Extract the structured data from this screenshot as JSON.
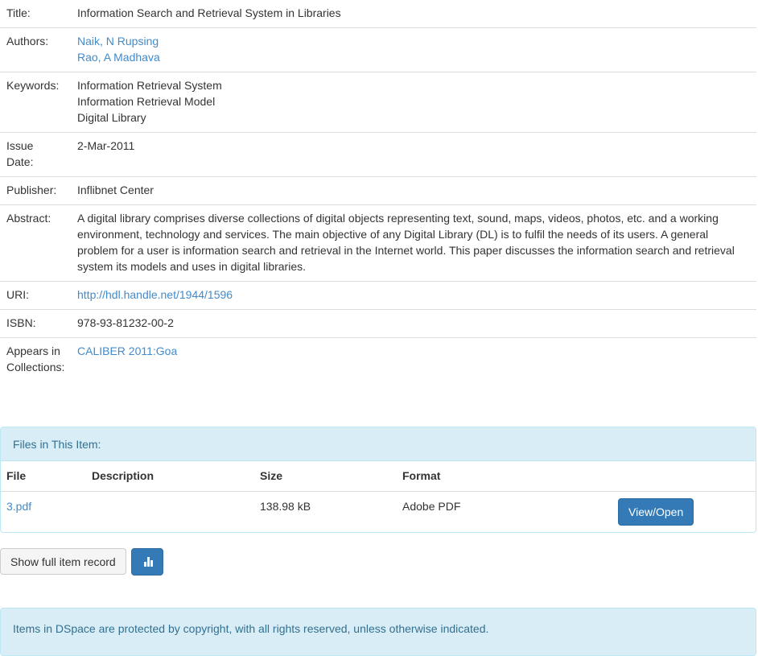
{
  "metadata": {
    "title_label": "Title:",
    "title": "Information Search and Retrieval System in Libraries",
    "authors_label": "Authors:",
    "authors": [
      "Naik, N Rupsing",
      "Rao, A Madhava"
    ],
    "keywords_label": "Keywords:",
    "keywords": [
      "Information Retrieval System",
      "Information Retrieval Model",
      "Digital Library"
    ],
    "issue_date_label_1": "Issue",
    "issue_date_label_2": "Date:",
    "issue_date": "2-Mar-2011",
    "publisher_label": "Publisher:",
    "publisher": "Inflibnet Center",
    "abstract_label": "Abstract:",
    "abstract": "A digital library comprises diverse collections of digital objects representing text, sound, maps, videos, photos, etc. and a working environment, technology and services. The main objective of any Digital Library (DL) is to fulfil the needs of its users. A general problem for a user is information search and retrieval in the Internet world. This paper discusses the information search and retrieval system its models and uses in digital libraries.",
    "uri_label": "URI:",
    "uri": "http://hdl.handle.net/1944/1596",
    "isbn_label": "ISBN:",
    "isbn": "978-93-81232-00-2",
    "collections_label_1": "Appears in",
    "collections_label_2": "Collections:",
    "collection": "CALIBER 2011:Goa"
  },
  "files": {
    "heading": "Files in This Item:",
    "columns": [
      "File",
      "Description",
      "Size",
      "Format"
    ],
    "rows": [
      {
        "file": "3.pdf",
        "description": "",
        "size": "138.98 kB",
        "format": "Adobe PDF",
        "action": "View/Open"
      }
    ]
  },
  "actions": {
    "show_full_record": "Show full item record",
    "stats_icon": "bar-chart-icon"
  },
  "footer": {
    "copyright": "Items in DSpace are protected by copyright, with all rights reserved, unless otherwise indicated."
  },
  "colors": {
    "link": "#428bca",
    "panel_info_bg": "#d9edf7",
    "panel_info_text": "#31708f",
    "primary": "#337ab7"
  }
}
